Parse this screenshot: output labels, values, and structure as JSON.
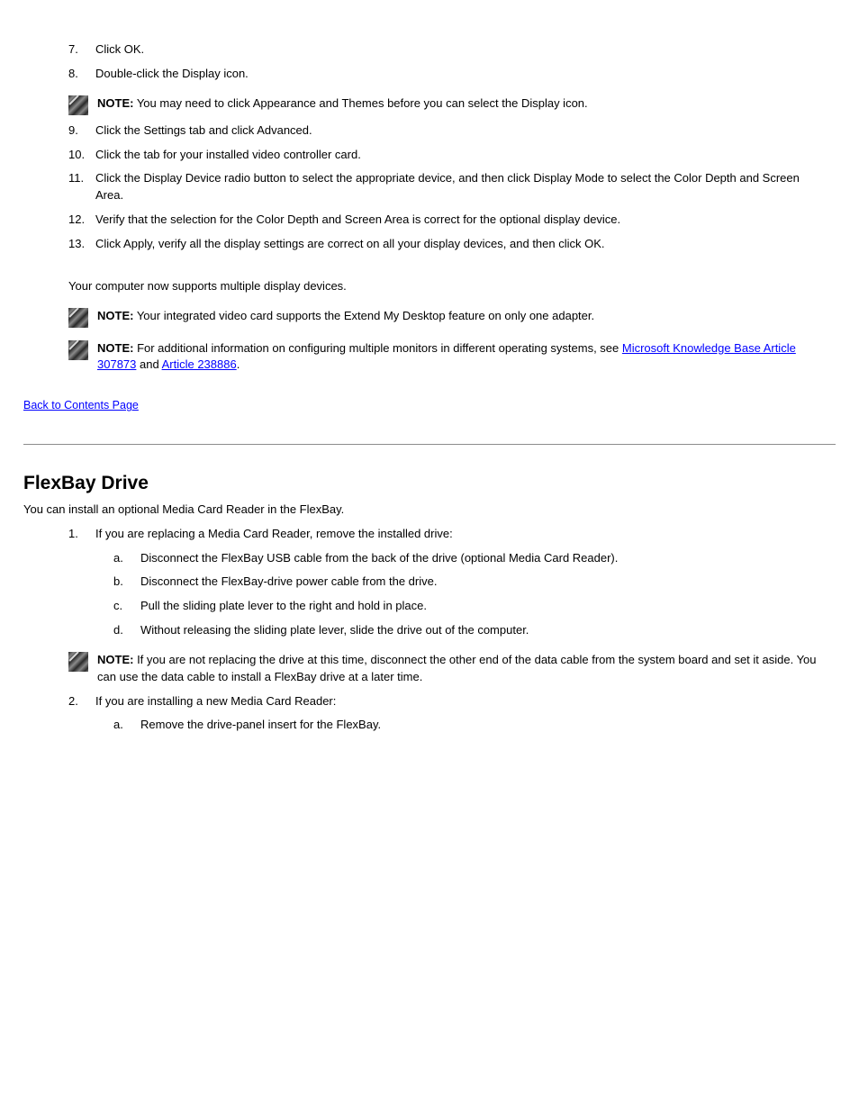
{
  "section1": {
    "steps": [
      {
        "num": "7.",
        "text": "Click OK."
      },
      {
        "num": "8.",
        "text": "Double-click the Display icon."
      }
    ],
    "note1": {
      "label": "NOTE:",
      "text": " You may need to click Appearance and Themes before you can select the Display icon."
    },
    "steps2": [
      {
        "num": "9.",
        "text": "Click the Settings tab and click Advanced."
      },
      {
        "num": "10.",
        "text": "Click the tab for your installed video controller card."
      },
      {
        "num": "11.",
        "text": "Click the Display Device radio button to select the appropriate device, and then click Display Mode to select the Color Depth and Screen Area."
      },
      {
        "num": "12.",
        "text": "Verify that the selection for the Color Depth and Screen Area is correct for the optional display device."
      },
      {
        "num": "13.",
        "text": "Click Apply, verify all the display settings are correct on all your display devices, and then click OK."
      }
    ],
    "closing": "Your computer now supports multiple display devices."
  },
  "notesBlock": {
    "n1": {
      "label": "NOTE:",
      "text": " Your integrated video card supports the Extend My Desktop feature on only one adapter."
    },
    "n2": {
      "label": "NOTE:",
      "pre": " For additional information on configuring multiple monitors in different operating systems, see ",
      "linkText1": "Microsoft Knowledge Base Article 307873",
      "mid": " and ",
      "linkText2": "Article 238886",
      "post": "."
    }
  },
  "backTop": "Back to Contents Page",
  "section2": {
    "title": "FlexBay Drive",
    "lead": "You can install an optional Media Card Reader in the FlexBay.",
    "steps": [
      {
        "num": "1.",
        "text": "If you are replacing a Media Card Reader, remove the installed drive:"
      },
      {
        "num": "a.",
        "text": "Disconnect the FlexBay USB cable from the back of the drive (optional Media Card Reader)."
      },
      {
        "num": "b.",
        "text": "Disconnect the FlexBay-drive power cable from the drive."
      },
      {
        "num": "c.",
        "text": "Pull the sliding plate lever to the right and hold in place."
      },
      {
        "num": "d.",
        "text": "Without releasing the sliding plate lever, slide the drive out of the computer."
      }
    ],
    "note": {
      "label": "NOTE:",
      "text": " If you are not replacing the drive at this time, disconnect the other end of the data cable from the system board and set it aside. You can use the data cable to install a FlexBay drive at a later time."
    },
    "steps2": [
      {
        "num": "2.",
        "text": "If you are installing a new Media Card Reader:"
      },
      {
        "num": "a.",
        "text": "Remove the drive-panel insert for the FlexBay."
      }
    ]
  }
}
